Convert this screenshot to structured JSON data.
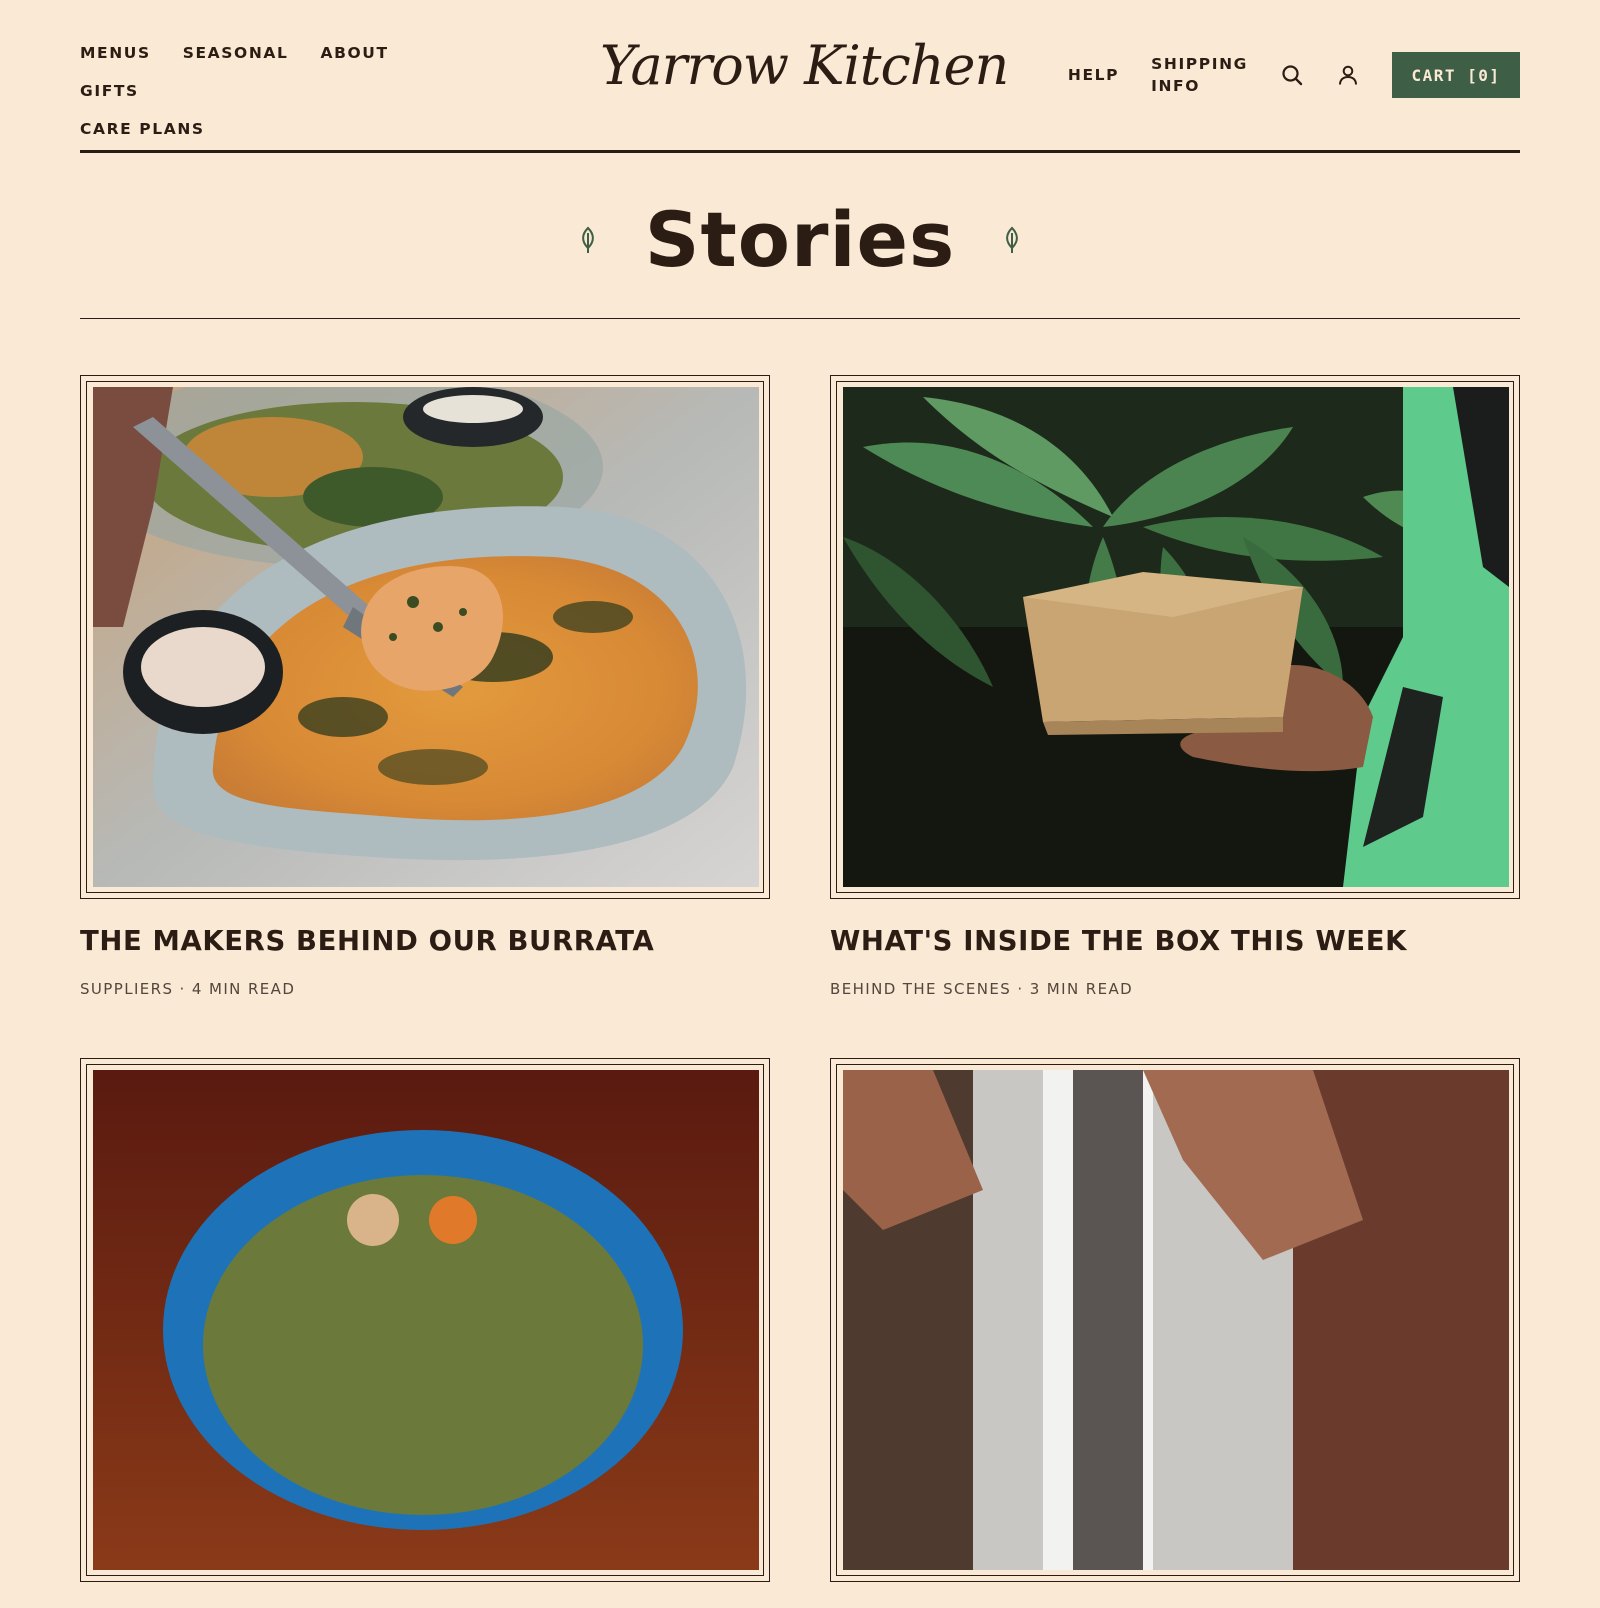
{
  "header": {
    "nav_left": [
      "MENUS",
      "SEASONAL",
      "ABOUT",
      "GIFTS",
      "CARE PLANS"
    ],
    "logo": "Yarrow Kitchen",
    "nav_right": {
      "help": "HELP",
      "shipping_line1": "SHIPPING",
      "shipping_line2": "INFO"
    },
    "icons": [
      "search-icon",
      "account-icon"
    ],
    "cart_label": "CART [0]"
  },
  "page": {
    "title": "Stories"
  },
  "stories": [
    {
      "title": "THE MAKERS BEHIND OUR BURRATA",
      "meta": "SUPPLIERS · 4 MIN READ",
      "image": "fork lifting a bite from a baked gratin dish"
    },
    {
      "title": "WHAT'S INSIDE THE BOX THIS WEEK",
      "meta": "BEHIND THE SCENES · 3 MIN READ",
      "image": "hand holding a kraft takeout box in front of leaves"
    },
    {
      "title": "",
      "meta": "",
      "image": "blue bowl of soup on a dark wooden table"
    },
    {
      "title": "",
      "meta": "",
      "image": "forearms of a cook in a kitchen"
    }
  ],
  "colors": {
    "background": "#f9e9d5",
    "text": "#2b1d14",
    "accent_green": "#3e5e45",
    "meta_text": "#54463c"
  }
}
